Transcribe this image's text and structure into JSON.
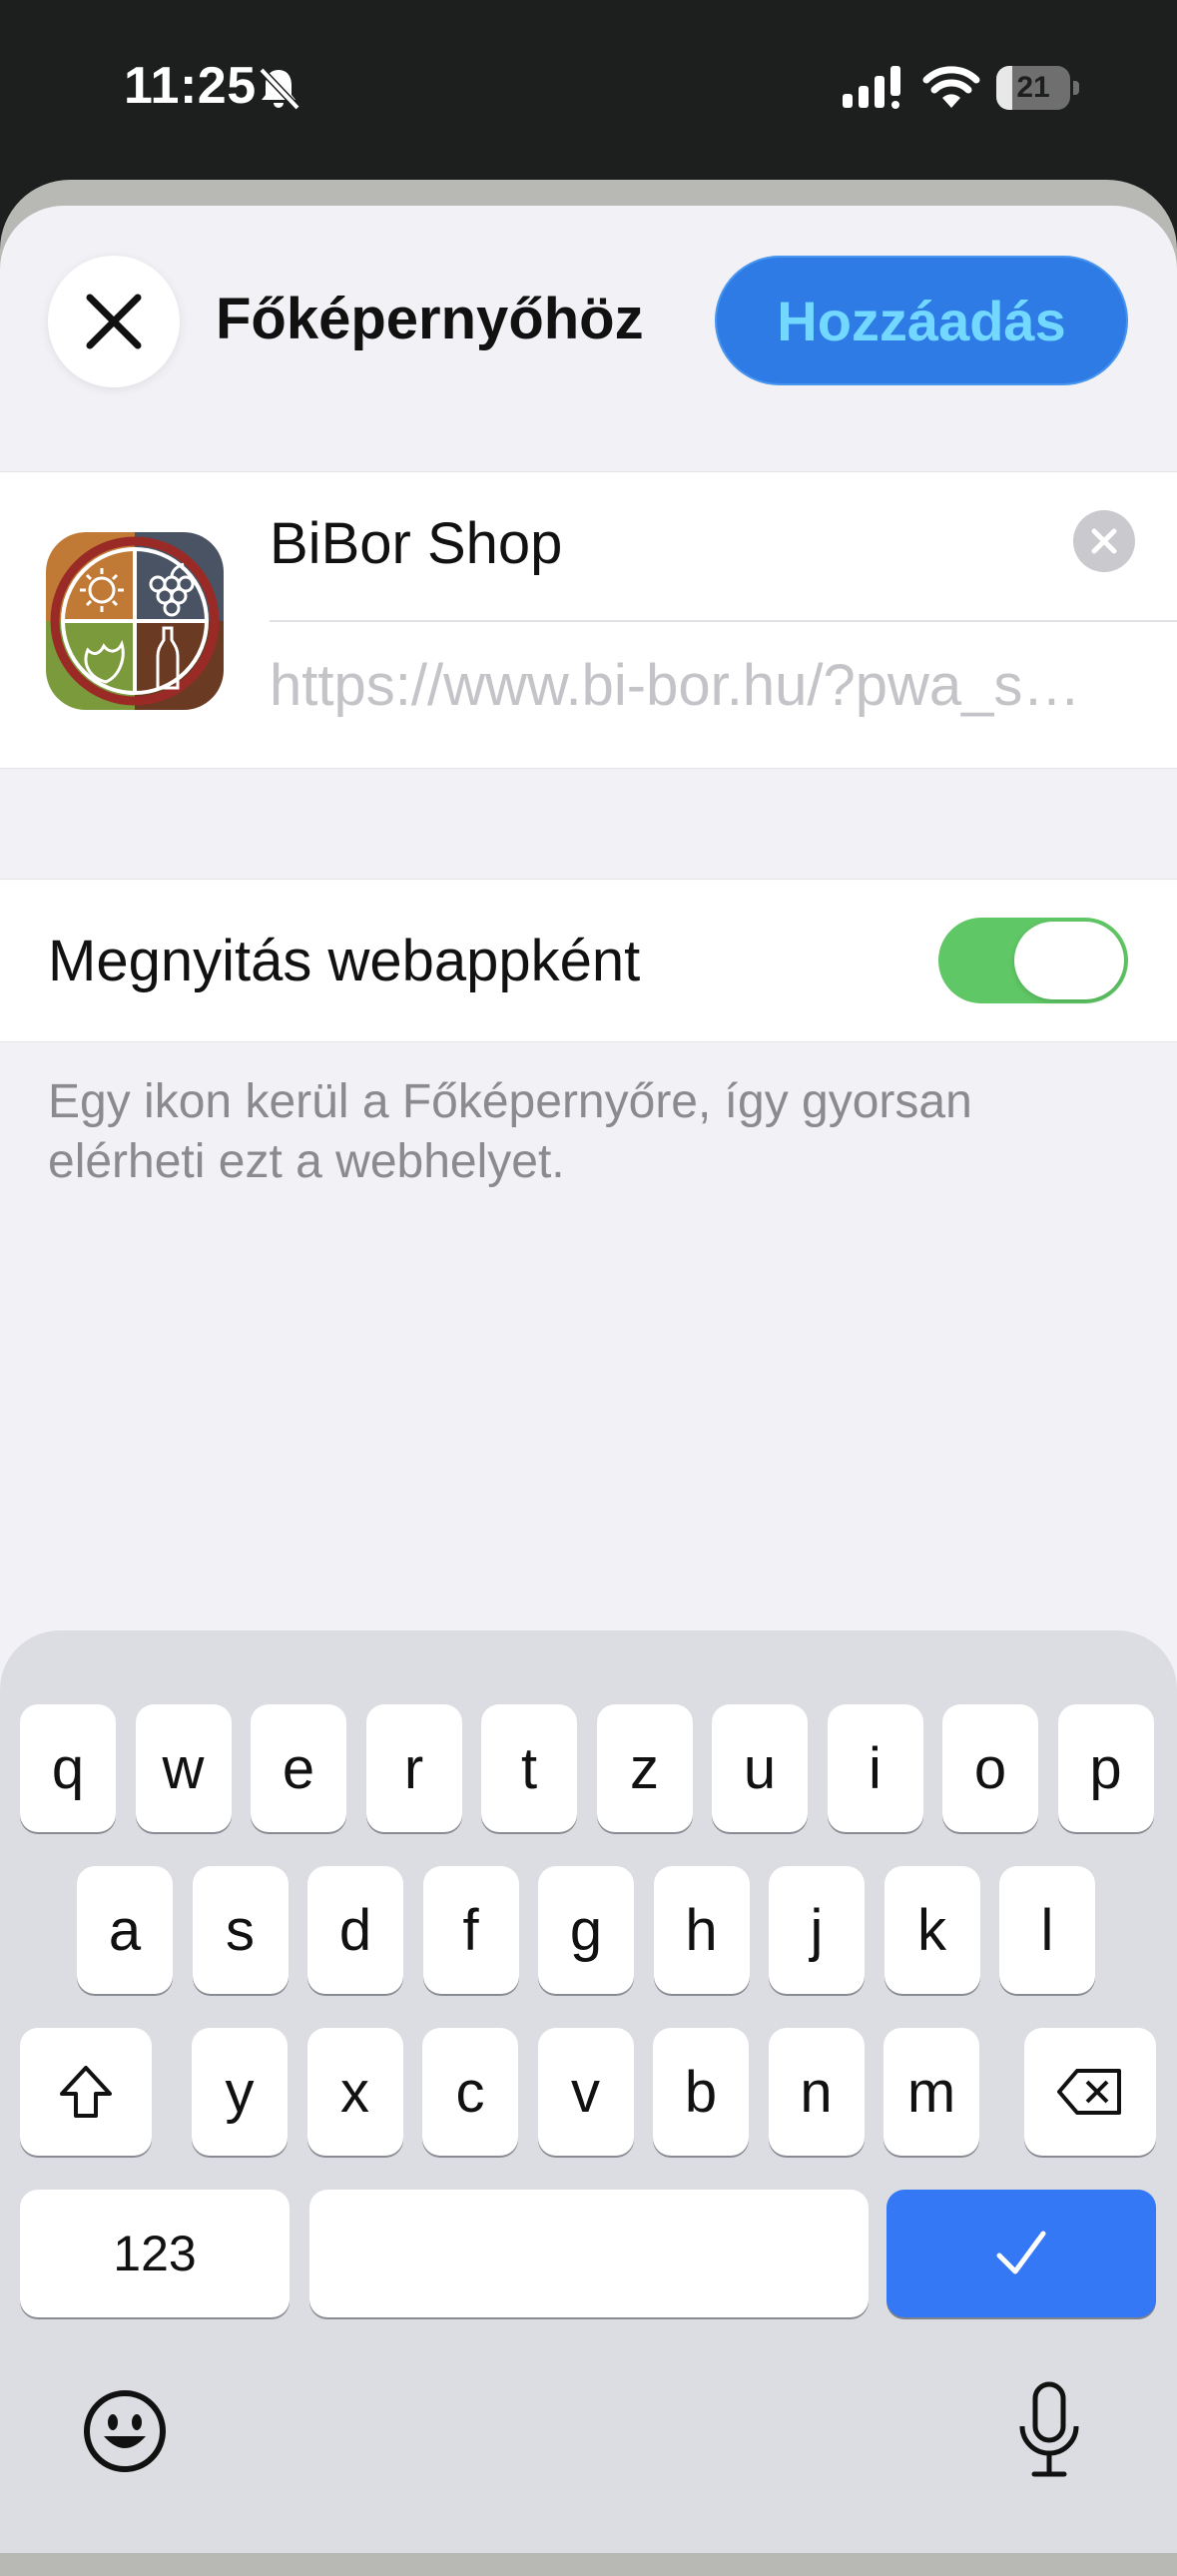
{
  "status_bar": {
    "time": "11:25",
    "battery": "21",
    "battery_level": 0.21
  },
  "header": {
    "title": "Főképernyőhöz",
    "add_label": "Hozzáadás"
  },
  "app": {
    "name": "BiBor Shop",
    "url": "https://www.bi-bor.hu/?pwa_source=1"
  },
  "setting": {
    "label": "Megnyitás webappként",
    "enabled": true
  },
  "footnote": "Egy ikon kerül a Főképernyőre, így gyorsan elérheti ezt a webhelyet.",
  "keyboard": {
    "row1": [
      "q",
      "w",
      "e",
      "r",
      "t",
      "z",
      "u",
      "i",
      "o",
      "p"
    ],
    "row2": [
      "a",
      "s",
      "d",
      "f",
      "g",
      "h",
      "j",
      "k",
      "l"
    ],
    "row3": [
      "y",
      "x",
      "c",
      "v",
      "b",
      "n",
      "m"
    ],
    "numbers_label": "123"
  },
  "colors": {
    "accent": "#2f7be6",
    "toggle_on": "#5fc765",
    "keyboard_bg": "#dcdde2"
  }
}
